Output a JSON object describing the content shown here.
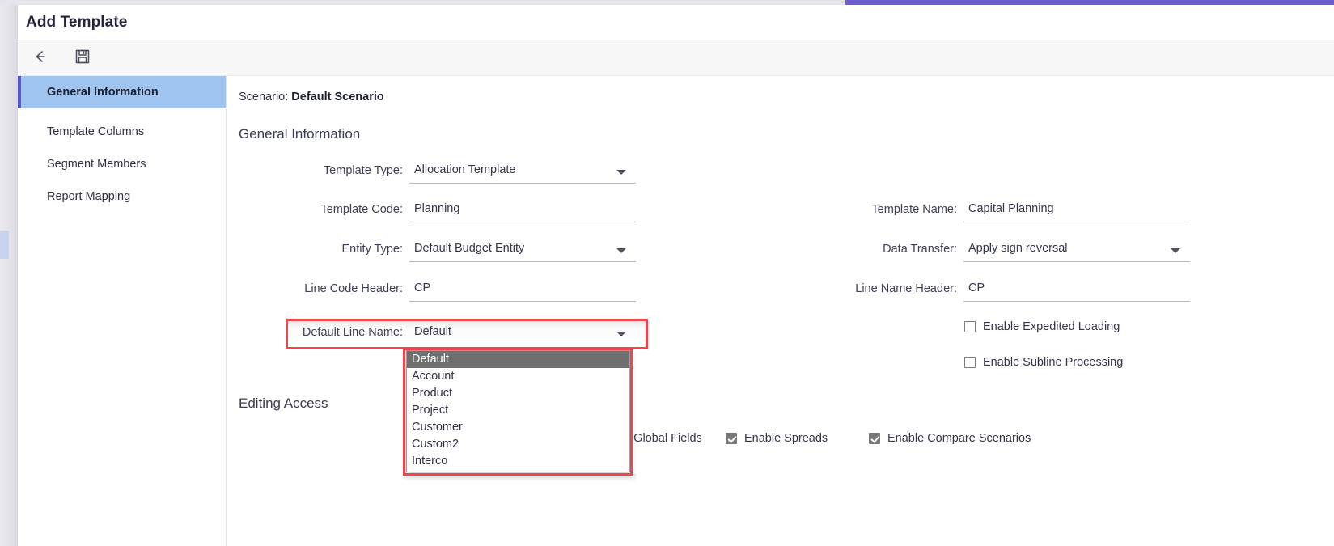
{
  "window": {
    "title": "Add Template",
    "accent_purple": "#6b5ece",
    "highlight_red": "#f4444a"
  },
  "toolbar": {
    "back_label": "back-arrow",
    "save_label": "save-diskette"
  },
  "sidebar": {
    "items": [
      {
        "label": "General Information",
        "active": true
      },
      {
        "label": "Template Columns",
        "active": false
      },
      {
        "label": "Segment Members",
        "active": false
      },
      {
        "label": "Report Mapping",
        "active": false
      }
    ]
  },
  "content": {
    "scenario_label": "Scenario:",
    "scenario_value": "Default Scenario",
    "section_general": "General Information",
    "section_editing": "Editing Access",
    "fields_left": [
      {
        "label": "Template Type:",
        "value": "Allocation Template",
        "type": "select"
      },
      {
        "label": "Template Code:",
        "value": "Planning",
        "type": "text"
      },
      {
        "label": "Entity Type:",
        "value": "Default Budget Entity",
        "type": "select"
      },
      {
        "label": "Line Code Header:",
        "value": "CP",
        "type": "text"
      },
      {
        "label": "Default Line Name:",
        "value": "Default",
        "type": "select"
      }
    ],
    "fields_right": [
      {
        "label": "Template Name:",
        "value": "Capital Planning",
        "type": "text"
      },
      {
        "label": "Data Transfer:",
        "value": "Apply sign reversal",
        "type": "select"
      },
      {
        "label": "Line Name Header:",
        "value": "CP",
        "type": "text"
      }
    ],
    "checkboxes_right": [
      {
        "label": "Enable Expedited Loading",
        "checked": false
      },
      {
        "label": "Enable Subline Processing",
        "checked": false
      }
    ],
    "checkboxes_bottom": [
      {
        "label": "Enable Global Fields",
        "checked": true
      },
      {
        "label": "Enable Spreads",
        "checked": true
      },
      {
        "label": "Enable Compare Scenarios",
        "checked": true
      }
    ]
  },
  "dropdown": {
    "open": true,
    "selected": "Default",
    "options": [
      "Default",
      "Account",
      "Product",
      "Project",
      "Customer",
      "Custom2",
      "Interco"
    ]
  }
}
